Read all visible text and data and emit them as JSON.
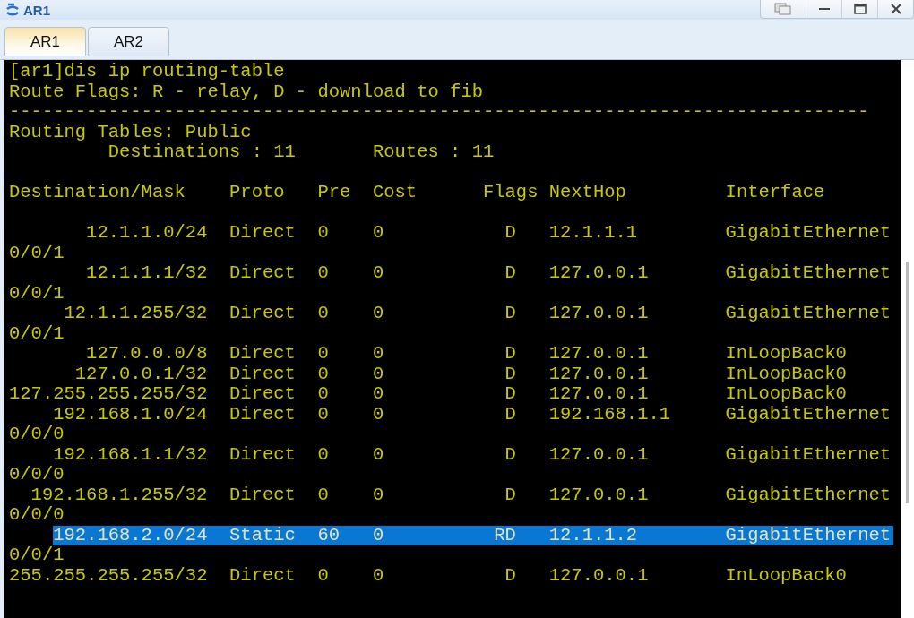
{
  "window": {
    "title": "AR1"
  },
  "tabs": [
    {
      "label": "AR1",
      "selected": true
    },
    {
      "label": "AR2",
      "selected": false
    }
  ],
  "terminal": {
    "command": "[ar1]dis ip routing-table",
    "flags_legend": "Route Flags: R - relay, D - download to fib",
    "separator": "------------------------------------------------------------------------------",
    "table_title": "Routing Tables: Public",
    "destinations": "Destinations : 11",
    "routes_count": "Routes : 11",
    "columns": [
      "Destination/Mask",
      "Proto",
      "Pre",
      "Cost",
      "Flags",
      "NextHop",
      "Interface"
    ],
    "routes": [
      {
        "destination": "12.1.1.0/24",
        "proto": "Direct",
        "pre": "0",
        "cost": "0",
        "flags": "D",
        "nexthop": "12.1.1.1",
        "interface": "GigabitEthernet",
        "interface_wrap": "0/0/1",
        "selected": false
      },
      {
        "destination": "12.1.1.1/32",
        "proto": "Direct",
        "pre": "0",
        "cost": "0",
        "flags": "D",
        "nexthop": "127.0.0.1",
        "interface": "GigabitEthernet",
        "interface_wrap": "0/0/1",
        "selected": false
      },
      {
        "destination": "12.1.1.255/32",
        "proto": "Direct",
        "pre": "0",
        "cost": "0",
        "flags": "D",
        "nexthop": "127.0.0.1",
        "interface": "GigabitEthernet",
        "interface_wrap": "0/0/1",
        "selected": false
      },
      {
        "destination": "127.0.0.0/8",
        "proto": "Direct",
        "pre": "0",
        "cost": "0",
        "flags": "D",
        "nexthop": "127.0.0.1",
        "interface": "InLoopBack0",
        "selected": false
      },
      {
        "destination": "127.0.0.1/32",
        "proto": "Direct",
        "pre": "0",
        "cost": "0",
        "flags": "D",
        "nexthop": "127.0.0.1",
        "interface": "InLoopBack0",
        "selected": false
      },
      {
        "destination": "127.255.255.255/32",
        "proto": "Direct",
        "pre": "0",
        "cost": "0",
        "flags": "D",
        "nexthop": "127.0.0.1",
        "interface": "InLoopBack0",
        "selected": false
      },
      {
        "destination": "192.168.1.0/24",
        "proto": "Direct",
        "pre": "0",
        "cost": "0",
        "flags": "D",
        "nexthop": "192.168.1.1",
        "interface": "GigabitEthernet",
        "interface_wrap": "0/0/0",
        "selected": false
      },
      {
        "destination": "192.168.1.1/32",
        "proto": "Direct",
        "pre": "0",
        "cost": "0",
        "flags": "D",
        "nexthop": "127.0.0.1",
        "interface": "GigabitEthernet",
        "interface_wrap": "0/0/0",
        "selected": false
      },
      {
        "destination": "192.168.1.255/32",
        "proto": "Direct",
        "pre": "0",
        "cost": "0",
        "flags": "D",
        "nexthop": "127.0.0.1",
        "interface": "GigabitEthernet",
        "interface_wrap": "0/0/0",
        "selected": false
      },
      {
        "destination": "192.168.2.0/24",
        "proto": "Static",
        "pre": "60",
        "cost": "0",
        "flags": "RD",
        "nexthop": "12.1.1.2",
        "interface": "GigabitEthernet",
        "interface_wrap": "0/0/1",
        "selected": true
      },
      {
        "destination": "255.255.255.255/32",
        "proto": "Direct",
        "pre": "0",
        "cost": "0",
        "flags": "D",
        "nexthop": "127.0.0.1",
        "interface": "InLoopBack0",
        "selected": false
      }
    ]
  }
}
